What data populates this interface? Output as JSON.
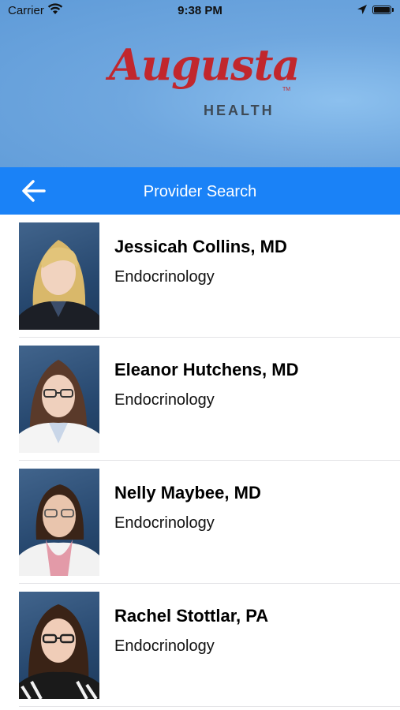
{
  "status_bar": {
    "carrier": "Carrier",
    "time": "9:38 PM"
  },
  "logo": {
    "script": "Augusta",
    "tm": "TM",
    "sub": "HEALTH",
    "brand_color": "#c1272d"
  },
  "nav": {
    "title": "Provider Search",
    "color": "#1a82f7"
  },
  "providers": [
    {
      "name": "Jessicah Collins, MD",
      "specialty": "Endocrinology"
    },
    {
      "name": "Eleanor Hutchens, MD",
      "specialty": "Endocrinology"
    },
    {
      "name": "Nelly Maybee, MD",
      "specialty": "Endocrinology"
    },
    {
      "name": "Rachel Stottlar, PA",
      "specialty": "Endocrinology"
    }
  ],
  "icons": [
    "wifi-icon",
    "location-arrow-icon",
    "battery-icon",
    "back-arrow-icon"
  ]
}
